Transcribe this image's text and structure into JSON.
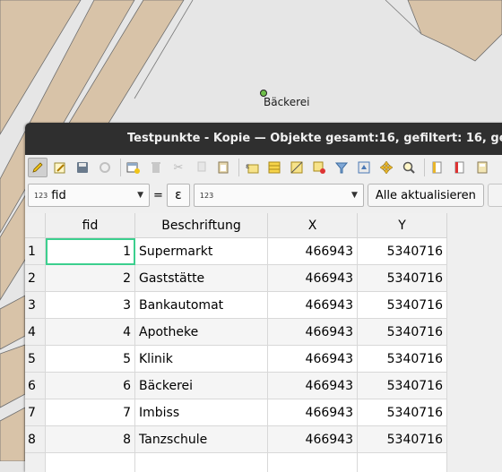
{
  "window": {
    "title": "Testpunkte - Kopie — Objekte gesamt:16, gefiltert: 16, gew"
  },
  "map": {
    "label": "Bäckerei",
    "colors": {
      "parcel": "#d8c3a8",
      "background": "#e6e6e6",
      "point": "#6fbf4a"
    }
  },
  "toolbar": {
    "icons": [
      "pencil-icon",
      "edit-multi-icon",
      "save-icon",
      "reload-icon",
      "add-feature-icon",
      "delete-icon",
      "cut-icon",
      "copy-icon",
      "paste-icon",
      "expression-select-icon",
      "select-all-icon",
      "invert-selection-icon",
      "deselect-icon",
      "filter-icon",
      "move-top-icon",
      "pan-to-icon",
      "zoom-to-icon",
      "new-field-icon",
      "delete-field-icon",
      "field-calculator-icon"
    ]
  },
  "filter": {
    "field_type": "123",
    "field": "fid",
    "equals": "=",
    "epsilon": "ε",
    "value_type": "123",
    "value": "",
    "update_button": "Alle aktualisieren"
  },
  "table": {
    "columns": [
      "fid",
      "Beschriftung",
      "X",
      "Y"
    ],
    "rows": [
      {
        "n": "1",
        "fid": "1",
        "Beschriftung": "Supermarkt",
        "X": "466943",
        "Y": "5340716"
      },
      {
        "n": "2",
        "fid": "2",
        "Beschriftung": "Gaststätte",
        "X": "466943",
        "Y": "5340716"
      },
      {
        "n": "3",
        "fid": "3",
        "Beschriftung": "Bankautomat",
        "X": "466943",
        "Y": "5340716"
      },
      {
        "n": "4",
        "fid": "4",
        "Beschriftung": "Apotheke",
        "X": "466943",
        "Y": "5340716"
      },
      {
        "n": "5",
        "fid": "5",
        "Beschriftung": "Klinik",
        "X": "466943",
        "Y": "5340716"
      },
      {
        "n": "6",
        "fid": "6",
        "Beschriftung": "Bäckerei",
        "X": "466943",
        "Y": "5340716"
      },
      {
        "n": "7",
        "fid": "7",
        "Beschriftung": "Imbiss",
        "X": "466943",
        "Y": "5340716"
      },
      {
        "n": "8",
        "fid": "8",
        "Beschriftung": "Tanzschule",
        "X": "466943",
        "Y": "5340716"
      }
    ]
  }
}
